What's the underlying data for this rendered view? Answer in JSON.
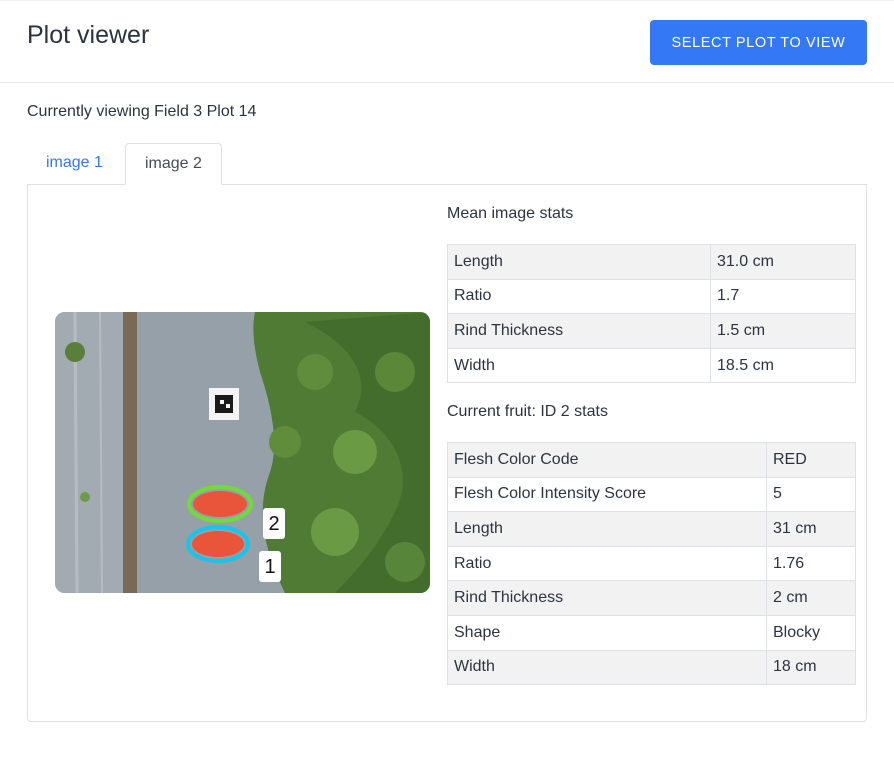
{
  "header": {
    "title": "Plot viewer",
    "select_button": "SELECT PLOT TO VIEW"
  },
  "viewing_text": "Currently viewing Field 3 Plot 14",
  "tabs": [
    {
      "label": "image 1",
      "active": false
    },
    {
      "label": "image 2",
      "active": true
    }
  ],
  "image": {
    "labels": [
      "2",
      "1"
    ],
    "ring_colors": [
      "#6fdc3a",
      "#18c4ea"
    ]
  },
  "mean_stats": {
    "title": "Mean image stats",
    "rows": [
      {
        "key": "Length",
        "value": "31.0 cm"
      },
      {
        "key": "Ratio",
        "value": "1.7"
      },
      {
        "key": "Rind Thickness",
        "value": "1.5 cm"
      },
      {
        "key": "Width",
        "value": "18.5 cm"
      }
    ]
  },
  "fruit_stats": {
    "title_prefix": "Current fruit: ",
    "title_id": "ID 2",
    "title_suffix": " stats",
    "rows": [
      {
        "key": "Flesh Color Code",
        "value": "RED"
      },
      {
        "key": "Flesh Color Intensity Score",
        "value": "5"
      },
      {
        "key": "Length",
        "value": "31 cm"
      },
      {
        "key": "Ratio",
        "value": "1.76"
      },
      {
        "key": "Rind Thickness",
        "value": "2 cm"
      },
      {
        "key": "Shape",
        "value": "Blocky"
      },
      {
        "key": "Width",
        "value": "18 cm"
      }
    ]
  },
  "colors": {
    "accent": "#3478f6",
    "text": "#2b3440",
    "stripe": "#f2f2f2"
  }
}
